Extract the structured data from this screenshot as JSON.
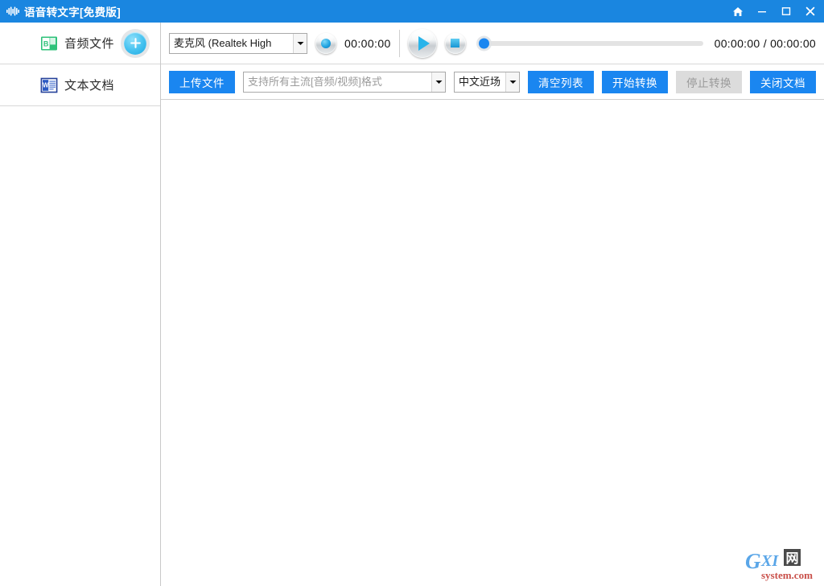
{
  "window": {
    "title": "语音转文字[免费版]",
    "app_icon": "audio-wave-icon",
    "titlebar_color": "#1a86e0",
    "controls": [
      {
        "name": "home",
        "icon": "home-icon"
      },
      {
        "name": "minimize",
        "icon": "minimize-icon"
      },
      {
        "name": "maximize",
        "icon": "maximize-icon"
      },
      {
        "name": "close",
        "icon": "close-icon"
      }
    ]
  },
  "sidebar": {
    "items": [
      {
        "label": "音频文件",
        "icon": "audio-file-icon",
        "has_add_button": true,
        "add_icon": "plus-icon"
      },
      {
        "label": "文本文档",
        "icon": "word-document-icon",
        "has_add_button": false
      }
    ]
  },
  "player": {
    "device": {
      "value": "麦克风 (Realtek High",
      "arrow_icon": "chevron-down-icon"
    },
    "record_button": {
      "name": "record-button",
      "icon": "record-dot-icon"
    },
    "record_time": "00:00:00",
    "play_button": {
      "name": "play-button",
      "icon": "play-triangle-icon"
    },
    "stop_button": {
      "name": "stop-button",
      "icon": "stop-square-icon"
    },
    "seek": {
      "progress_percent": 0
    },
    "time_display": "00:00:00 / 00:00:00"
  },
  "actions": {
    "upload_label": "上传文件",
    "file_placeholder": "支持所有主流[音频/视频]格式",
    "file_value": "",
    "language": {
      "value": "中文近场",
      "arrow_icon": "chevron-down-icon"
    },
    "clear_label": "清空列表",
    "start_label": "开始转换",
    "stop_label": "停止转换",
    "stop_disabled": true,
    "close_doc_label": "关闭文档",
    "accent_color": "#1a86f0",
    "disabled_color": "#dcdcdc"
  },
  "content": {
    "items": []
  },
  "watermark": {
    "main_text": "GXI",
    "cjk_text": "网",
    "sub_text": "system.com"
  }
}
